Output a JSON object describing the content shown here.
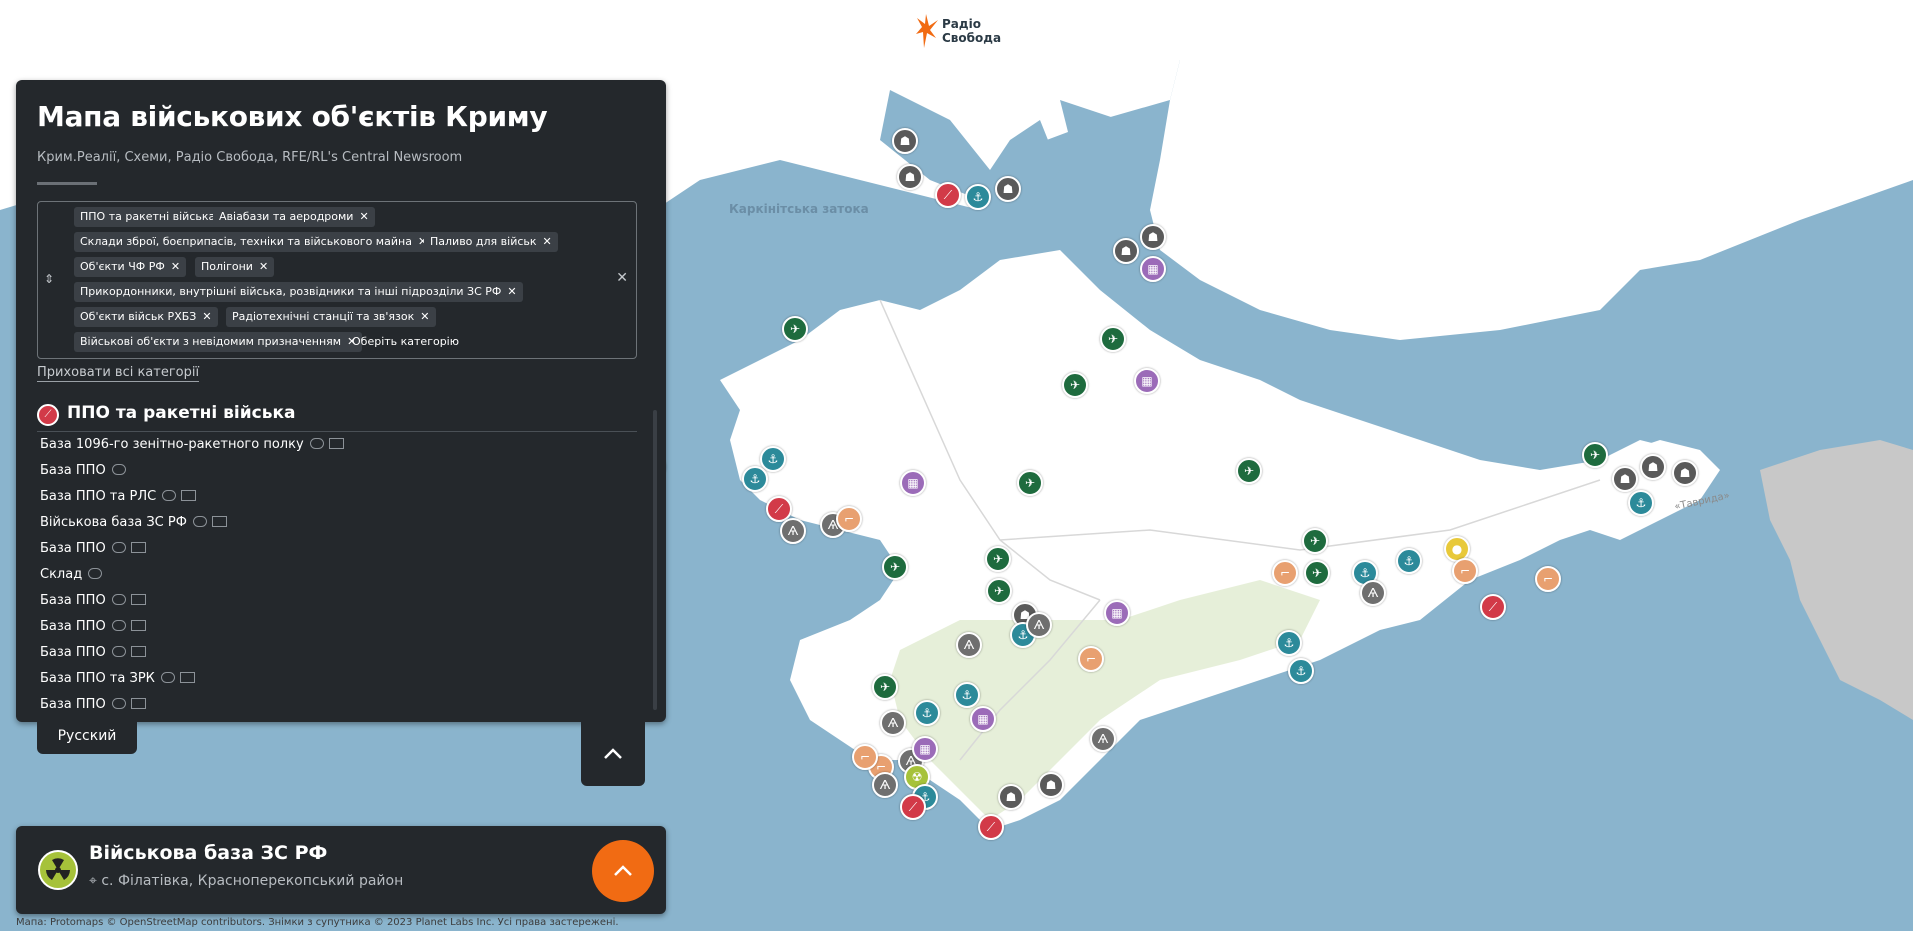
{
  "header": {
    "logo_line1": "Радіо",
    "logo_line2": "Свобода",
    "logo_color": "#f16b13"
  },
  "map": {
    "labels": {
      "gulf": "Каркінітська затока",
      "road": "«Таврида»"
    },
    "colors": {
      "sea": "#8ab4cd",
      "land": "#ffffff",
      "mainland_gray": "#c8c8c8",
      "mountains": "#e6efd9"
    },
    "marker_types": {
      "ppo": {
        "color": "#d23a48",
        "icon": "rocket-icon",
        "glyph": "⟋"
      },
      "air": {
        "color": "#1e6b3e",
        "icon": "plane-icon",
        "glyph": "✈"
      },
      "navy": {
        "color": "#2c8a9a",
        "icon": "anchor-icon",
        "glyph": "⚓"
      },
      "border": {
        "color": "#5a5a5a",
        "icon": "soldier-icon",
        "glyph": "☗"
      },
      "depot": {
        "color": "#9b6bb8",
        "icon": "warehouse-icon",
        "glyph": "▦"
      },
      "radio": {
        "color": "#6f6f6f",
        "icon": "antenna-icon",
        "glyph": "Ѧ"
      },
      "range": {
        "color": "#e8a070",
        "icon": "gun-icon",
        "glyph": "⌐"
      },
      "fuel": {
        "color": "#e8c93a",
        "icon": "fuel-icon",
        "glyph": "●"
      },
      "unknown": {
        "color": "#9aa0a6",
        "icon": "question-icon",
        "glyph": "?"
      }
    }
  },
  "panel": {
    "title": "Мапа військових об'єктів Криму",
    "credits": "Крим.Реалії, Схеми, Радіо Свобода, RFE/RL's Central Newsroom",
    "chips": [
      "ППО та ракетні війська",
      "Авіабази та аеродроми",
      "Склади зброї, боєприпасів, техніки та військового майна",
      "Паливо для військ",
      "Об'єкти ЧФ РФ",
      "Полігони",
      "Прикордонники, внутрішні війська, розвідники та інші підрозділи ЗС РФ",
      "Об'єкти військ РХБЗ",
      "Радіотехнічні станції та зв'язок",
      "Військові об'єкти з невідомим призначенням"
    ],
    "chip_placeholder": "Оберіть категорію",
    "hide_all": "Приховати всі категорії",
    "section_title": "ППО та ракетні війська",
    "items": [
      {
        "label": "База 1096-го зенітно-ракетного полку",
        "photo": true
      },
      {
        "label": "База ППО",
        "photo": false
      },
      {
        "label": "База ППО та РЛС",
        "photo": true
      },
      {
        "label": "Військова база ЗС РФ",
        "photo": true
      },
      {
        "label": "База ППО",
        "photo": true
      },
      {
        "label": "Склад",
        "photo": false
      },
      {
        "label": "База ППО",
        "photo": true
      },
      {
        "label": "База ППО",
        "photo": true
      },
      {
        "label": "База ППО",
        "photo": true
      },
      {
        "label": "База ППО та ЗРК",
        "photo": true
      },
      {
        "label": "База ППО",
        "photo": true
      }
    ]
  },
  "language_button": "Русский",
  "info_card": {
    "title": "Військова база ЗС РФ",
    "place": "с. Філатівка, Красноперекопський район"
  },
  "attribution": "Мапа: Protomaps © OpenStreetMap contributors. Знімки з супутника © 2023 Planet Labs Inc. Усі права застережені."
}
